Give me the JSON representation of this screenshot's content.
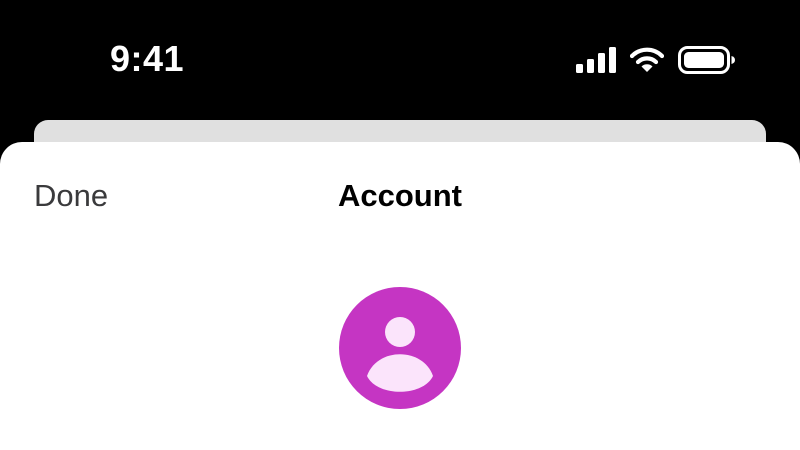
{
  "status_bar": {
    "time": "9:41",
    "icons": [
      "cellular-signal-icon",
      "wifi-icon",
      "battery-icon"
    ]
  },
  "sheet": {
    "done_label": "Done",
    "title": "Account"
  },
  "avatar": {
    "icon": "person-avatar-icon",
    "background_color": "#c535c3"
  },
  "colors": {
    "background": "#000000",
    "sheet": "#ffffff",
    "sheet_back": "#e0e0e0",
    "done_text": "#3a3a3c",
    "avatar": "#c535c3",
    "avatar_figure": "#fbe4fb"
  }
}
